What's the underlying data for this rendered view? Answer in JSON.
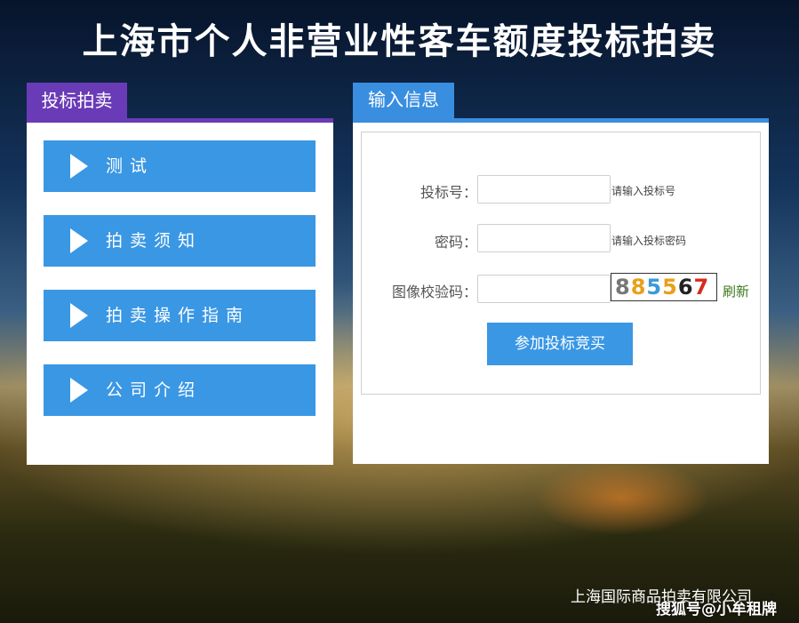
{
  "page_title": "上海市个人非营业性客车额度投标拍卖",
  "left_panel": {
    "tab_label": "投标拍卖",
    "menu": [
      {
        "label": "测试"
      },
      {
        "label": "拍卖须知"
      },
      {
        "label": "拍卖操作指南"
      },
      {
        "label": "公司介绍"
      }
    ]
  },
  "right_panel": {
    "tab_label": "输入信息",
    "form": {
      "bid_number": {
        "label": "投标号：",
        "value": "",
        "hint": "请输入投标号"
      },
      "password": {
        "label": "密码：",
        "value": "",
        "hint": "请输入投标密码"
      },
      "captcha": {
        "label": "图像校验码：",
        "value": "",
        "code": "885567",
        "refresh_label": "刷新"
      },
      "submit_label": "参加投标竞买"
    }
  },
  "footer": {
    "company": "上海国际商品拍卖有限公司",
    "watermark": "搜狐号@小牟租牌"
  },
  "colors": {
    "left_accent": "#6a3bb7",
    "right_accent": "#3a8ee0",
    "button_blue": "#3a97e4",
    "refresh_green": "#3a7a1c"
  }
}
